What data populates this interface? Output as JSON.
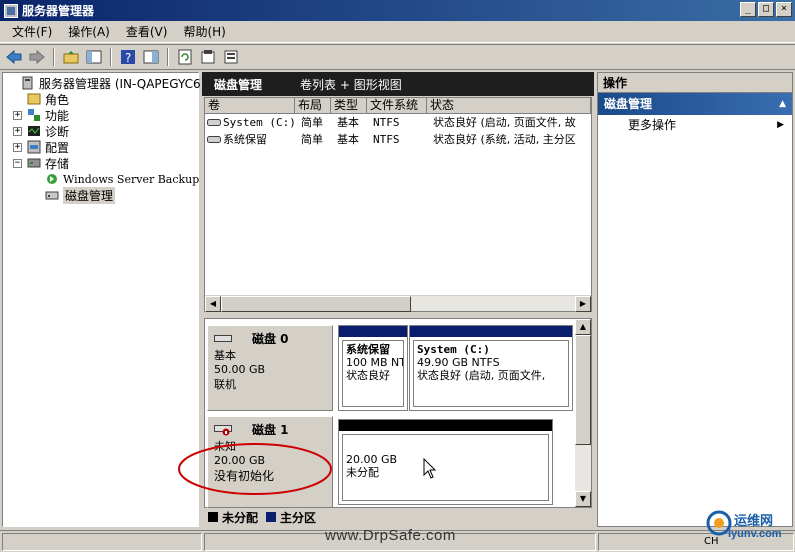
{
  "window": {
    "title": "服务器管理器"
  },
  "menu": [
    "文件(F)",
    "操作(A)",
    "查看(V)",
    "帮助(H)"
  ],
  "toolbar_icons": [
    "back-icon",
    "forward-icon",
    "up-folder-icon",
    "show-hide-tree-icon",
    "help-icon",
    "properties-pane-icon",
    "refresh-icon",
    "properties-icon",
    "export-icon"
  ],
  "tree": {
    "root": "服务器管理器 (IN-QAPEGYC6)",
    "items": [
      {
        "label": "角色",
        "expander": ""
      },
      {
        "label": "功能",
        "expander": "+"
      },
      {
        "label": "诊断",
        "expander": "+"
      },
      {
        "label": "配置",
        "expander": "+"
      },
      {
        "label": "存储",
        "expander": "−"
      },
      {
        "label": "Windows Server Backup",
        "expander": ""
      },
      {
        "label": "磁盘管理",
        "expander": ""
      }
    ]
  },
  "center": {
    "title": "磁盘管理",
    "view": "卷列表 + 图形视图",
    "columns": [
      "卷",
      "布局",
      "类型",
      "文件系统",
      "状态"
    ],
    "rows": [
      {
        "volume": "System (C:)",
        "layout": "简单",
        "type": "基本",
        "fs": "NTFS",
        "status": "状态良好 (启动, 页面文件, 故"
      },
      {
        "volume": "系统保留",
        "layout": "简单",
        "type": "基本",
        "fs": "NTFS",
        "status": "状态良好 (系统, 活动, 主分区"
      }
    ],
    "disks": [
      {
        "name": "磁盘 0",
        "kind": "基本",
        "size": "50.00 GB",
        "state": "联机",
        "partitions": [
          {
            "name": "系统保留",
            "size": "100 MB NT",
            "status": "状态良好"
          },
          {
            "name": "System  (C:)",
            "size": "49.90 GB NTFS",
            "status": "状态良好 (启动, 页面文件,"
          }
        ]
      },
      {
        "name": "磁盘 1",
        "kind": "未知",
        "size": "20.00 GB",
        "state": "没有初始化",
        "partitions": [
          {
            "size": "20.00 GB",
            "status": "未分配"
          }
        ]
      }
    ],
    "legend": [
      {
        "label": "未分配",
        "color": "#000000"
      },
      {
        "label": "主分区",
        "color": "#0a1e6e"
      }
    ]
  },
  "actions": {
    "header": "操作",
    "section": "磁盘管理",
    "items": [
      "更多操作"
    ]
  },
  "footer": {
    "watermark": "www.DrpSafe.com",
    "logo_title": "运维网",
    "logo_url": "iyunv.com",
    "lang": "CH"
  },
  "colors": {
    "title_bar": "#0a246a",
    "primary_partition": "#0a1e6e",
    "unallocated": "#000000",
    "annotation": "#cc0000"
  }
}
